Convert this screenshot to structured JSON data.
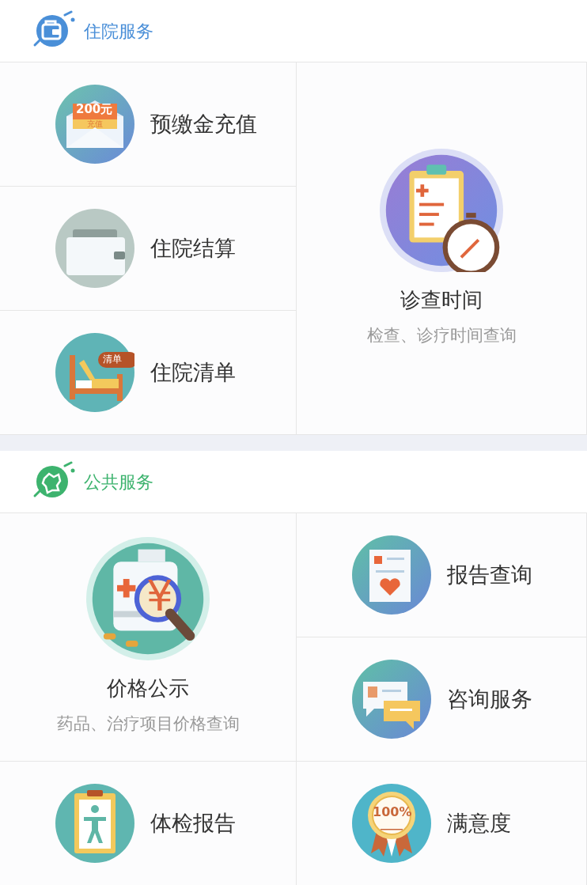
{
  "sections": [
    {
      "title": "住院服务",
      "color": "#4a8fd8",
      "tiles": [
        {
          "kind": "small",
          "title": "预缴金充值",
          "badges": [
            "200元",
            "充值"
          ]
        },
        {
          "kind": "tall",
          "title": "诊查时间",
          "subtitle": "检查、诊疗时间查询"
        },
        {
          "kind": "small",
          "title": "住院结算"
        },
        {
          "kind": "small",
          "title": "住院清单",
          "badges": [
            "清单"
          ]
        }
      ]
    },
    {
      "title": "公共服务",
      "color": "#3db36e",
      "tiles": [
        {
          "kind": "medium",
          "title": "价格公示",
          "subtitle": "药品、治疗项目价格查询",
          "badges": [
            "¥"
          ]
        },
        {
          "kind": "small",
          "title": "报告查询"
        },
        {
          "kind": "small",
          "title": "咨询服务"
        },
        {
          "kind": "small",
          "title": "体检报告"
        },
        {
          "kind": "small",
          "title": "满意度",
          "badges": [
            "100%"
          ]
        }
      ]
    }
  ]
}
